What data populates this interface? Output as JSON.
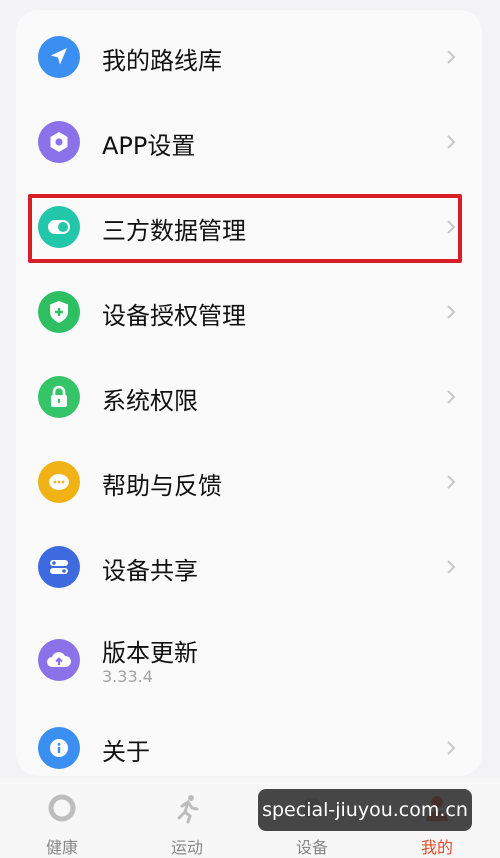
{
  "menu": {
    "items": [
      {
        "label": "我的路线库",
        "icon": "navigation-arrow-icon",
        "color": "#3a8ff0"
      },
      {
        "label": "APP设置",
        "icon": "gear-hexagon-icon",
        "color": "#8b72e8"
      },
      {
        "label": "三方数据管理",
        "icon": "toggle-icon",
        "color": "#22c6a8"
      },
      {
        "label": "设备授权管理",
        "icon": "shield-plus-icon",
        "color": "#2fbf63"
      },
      {
        "label": "系统权限",
        "icon": "lock-icon",
        "color": "#35c467"
      },
      {
        "label": "帮助与反馈",
        "icon": "chat-bubble-icon",
        "color": "#f1b215"
      },
      {
        "label": "设备共享",
        "icon": "share-toggle-icon",
        "color": "#3e6ae0"
      },
      {
        "label": "版本更新",
        "sub": "3.33.4",
        "icon": "cloud-upload-icon",
        "color": "#8b72e8"
      },
      {
        "label": "关于",
        "icon": "info-icon",
        "color": "#3a8ff0"
      }
    ]
  },
  "tabbar": {
    "tabs": [
      {
        "label": "健康",
        "icon": "ring-icon"
      },
      {
        "label": "运动",
        "icon": "running-person-icon"
      },
      {
        "label": "设备",
        "icon": "watch-icon"
      },
      {
        "label": "我的",
        "icon": "person-icon",
        "active": true
      }
    ],
    "active_color": "#e24b2c"
  },
  "watermark": {
    "text": "special-jiuyou.com.cn"
  }
}
